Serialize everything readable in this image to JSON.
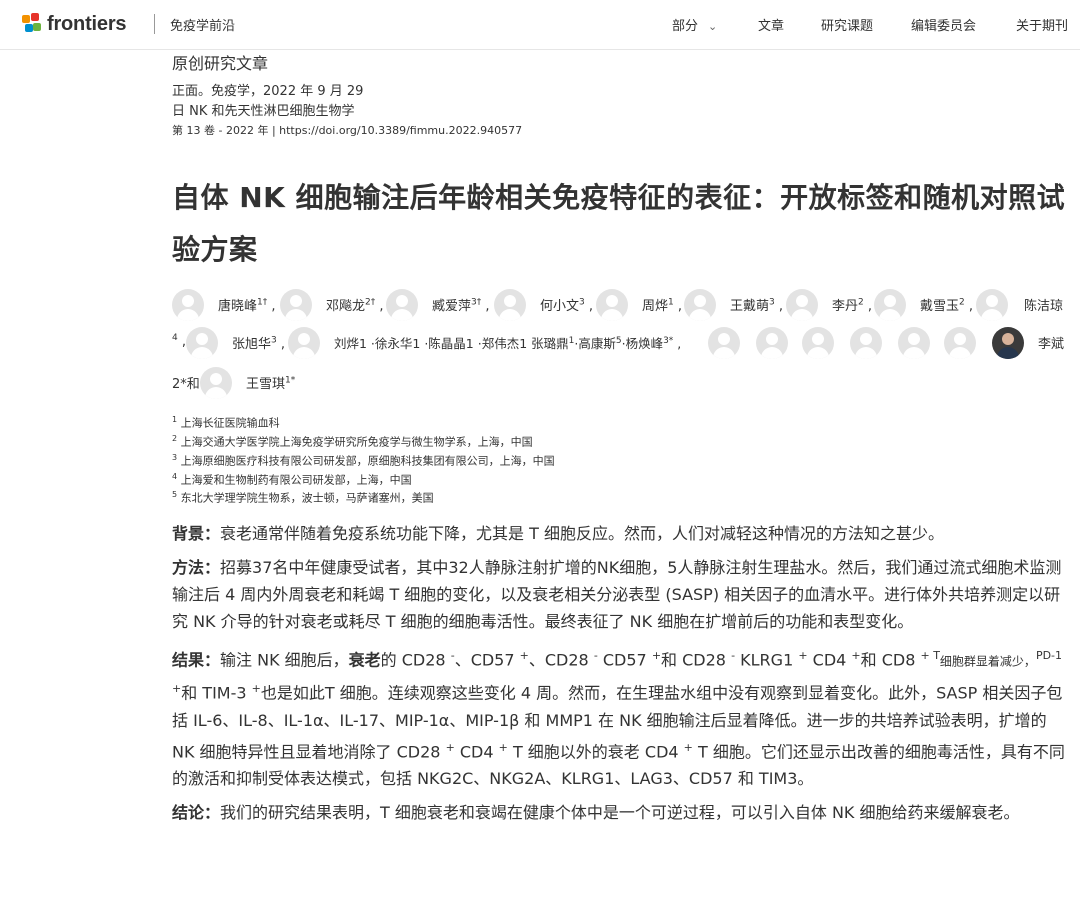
{
  "header": {
    "logo_text": "frontiers",
    "journal": "免疫学前沿",
    "nav": [
      "部分",
      "文章",
      "研究课题",
      "编辑委员会",
      "关于期刊"
    ]
  },
  "article": {
    "type": "原创研究文章",
    "published": "正面。免疫学，2022 年 9 月 29",
    "section": "日 NK 和先天性淋巴细胞生物学",
    "citation": "第 13 卷 - 2022 年 | https://doi.org/10.3389/fimmu.2022.940577",
    "title_pre": "自体 ",
    "title_bold": "NK",
    "title_post": " 细胞输注后年龄相关免疫特征的表征：开放标签和随机对照试验方案"
  },
  "authors": {
    "line1": [
      {
        "name": "唐晓峰",
        "sup": "1†"
      },
      {
        "name": "邓飚龙",
        "sup": "2†"
      },
      {
        "name": "臧爱萍",
        "sup": "3†"
      },
      {
        "name": "何小文",
        "sup": "3"
      },
      {
        "name": "周烨",
        "sup": "1"
      },
      {
        "name": "王戴萌",
        "sup": "3"
      },
      {
        "name": "李丹",
        "sup": "2"
      },
      {
        "name": "戴雪玉",
        "sup": "2"
      },
      {
        "name": "陈洁琼",
        "sup": ""
      }
    ],
    "line2_lead": "4",
    "line2_name": "张旭华",
    "line2_sup": "3",
    "line2_group": "刘烨1 ·徐永华1 ·陈晶晶1 ·郑伟杰1 张璐鼎",
    "line2_group_sup": "1",
    "line2_group2": "·高康斯",
    "line2_group2_sup": "5",
    "line2_group3": "·杨焕峰",
    "line2_group3_sup": "3*",
    "line2_last": "李斌",
    "line3_lead": "2*和",
    "line3_name": "王雪琪",
    "line3_sup": "1*"
  },
  "affiliations": [
    {
      "num": "1",
      "text": "上海长征医院输血科"
    },
    {
      "num": "2",
      "text": "上海交通大学医学院上海免疫学研究所免疫学与微生物学系，上海，中国"
    },
    {
      "num": "3",
      "text": "上海原细胞医疗科技有限公司研发部，原细胞科技集团有限公司，上海，中国"
    },
    {
      "num": "4",
      "text": "上海爱和生物制药有限公司研发部，上海，中国"
    },
    {
      "num": "5",
      "text": "东北大学理学院生物系，波士顿，马萨诸塞州，美国"
    }
  ],
  "abstract": {
    "background_label": "背景：",
    "background_text": "衰老通常伴随着免疫系统功能下降，尤其是 T 细胞反应。然而，人们对减轻这种情况的方法知之甚少。",
    "methods_label": "方法：",
    "methods_text": "招募37名中年健康受试者，其中32人静脉注射扩增的NK细胞，5人静脉注射生理盐水。然后，我们通过流式细胞术监测输注后 4 周内外周衰老和耗竭 T 细胞的变化，以及衰老相关分泌表型 (SASP) 相关因子的血清水平。进行体外共培养测定以研究 NK 介导的针对衰老或耗尽 T 细胞的细胞毒活性。最终表征了 NK 细胞在扩增前后的功能和表型变化。",
    "results_label": "结果：",
    "results_a": "输注 NK 细胞后，",
    "results_b": "衰老",
    "results_c": "的 CD28 ",
    "results_d": "、CD57 ",
    "results_e": "、CD28 ",
    "results_f": " CD57 ",
    "results_g": "和 CD28 ",
    "results_h": " KLRG1 ",
    "results_i": " CD4 ",
    "results_j": "和 CD8 ",
    "results_k": "细胞群显着减少，",
    "results_l": "PD-1 ",
    "results_m": "和 TIM-3 ",
    "results_n": "也是如此T 细胞。连续观察这些变化 4 周。然而，在生理盐水组中没有观察到显着变化。此外，SASP 相关因子包括 IL-6、IL-8、IL-1α、IL-17、MIP-1α、MIP-1β 和 MMP1 在 NK 细胞输注后显着降低。进一步的共培养试验表明，扩增的 NK 细胞特异性且显着地消除了 CD28 ",
    "results_o": " CD4 ",
    "results_p": " T 细胞以外的衰老 CD4 ",
    "results_q": " T 细胞。它们还显示出改善的细胞毒活性，具有不同的激活和抑制受体表达模式，包括 NKG2C、NKG2A、KLRG1、LAG3、CD57 和 TIM3。",
    "sup_minus": "-",
    "sup_plus": "+",
    "sup_plus_t": "+ T",
    "conclusion_label": "结论：",
    "conclusion_text": "我们的研究结果表明，T 细胞衰老和衰竭在健康个体中是一个可逆过程，可以引入自体 NK 细胞给药来缓解衰老。"
  },
  "colors": {
    "logo_orange": "#f39200",
    "logo_red": "#e6332a",
    "logo_blue": "#0090d0",
    "logo_green": "#6db33f"
  }
}
